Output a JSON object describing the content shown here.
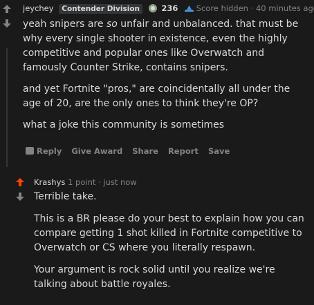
{
  "comment1": {
    "author": "jeychey",
    "flair": "Contender Division",
    "flair_count": "236",
    "score_status": "Score hidden",
    "time": "40 minutes ago",
    "paragraphs": [
      {
        "pre": "yeah snipers are ",
        "em": "so",
        "post": " unfair and unbalanced. that must be why every single shooter in existence, even the highly competitive and popular ones like Overwatch and famously Counter Strike, contains snipers."
      },
      {
        "text": "and yet Fortnite \"pros,\" are coincidentally all under the age of 20, are the only ones to think they're OP?"
      },
      {
        "text": "what a joke this community is sometimes"
      }
    ],
    "actions": [
      "Reply",
      "Give Award",
      "Share",
      "Report",
      "Save"
    ]
  },
  "comment2": {
    "author": "Krashys",
    "points": "1 point",
    "time": "just now",
    "paragraphs": [
      "Terrible take.",
      "This is a BR please do your best to explain how you can compare getting 1 shot killed in Fortnite competitive to Overwatch or CS where you literally respawn.",
      "Your argument is rock solid until you realize we're talking about battle royales."
    ]
  },
  "colors": {
    "upvote_active": "#ff4500",
    "muted": "#818384",
    "text": "#d7dadc",
    "background": "#1a1a1b"
  },
  "icons": [
    "upvote-arrow-icon",
    "downvote-arrow-icon",
    "flair-badge-icon",
    "score-hidden-icon",
    "reply-icon"
  ]
}
